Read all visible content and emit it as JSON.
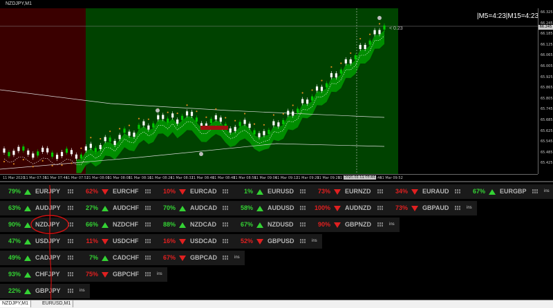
{
  "chart": {
    "title": "NZDJPY,M1",
    "timeframe_label": "|M5=4:23|M15=4:23",
    "price_label": "< 0.23",
    "current_price": "66.245",
    "price_ticks": [
      "66.325",
      "66.245",
      "66.185",
      "66.125",
      "66.065",
      "66.005",
      "65.925",
      "65.865",
      "65.805",
      "65.745",
      "65.685",
      "65.625",
      "65.545",
      "65.485",
      "65.425"
    ],
    "time_ticks": [
      "11 Mar 2020",
      "11 Mar 07:36",
      "11 Mar 07:44",
      "11 Mar 07:52",
      "11 Mar 08:00",
      "11 Mar 08:08",
      "11 Mar 08:16",
      "11 Mar 08:24",
      "11 Mar 08:32",
      "11 Mar 08:40",
      "11 Mar 08:48",
      "11 Mar 08:56",
      "11 Mar 09:04",
      "11 Mar 09:12",
      "11 Mar 09:20",
      "11 Mar 09:28",
      "11 Mar 09:36",
      "11 Mar 09:44",
      "11 Mar 09:52"
    ],
    "time_cursor": "2020.03.11 09:44",
    "colors": {
      "red_zone": "#3a0000",
      "green_zone": "#004200",
      "bull": "#ffffff",
      "bear": "#00c800",
      "cloud": "#009a00"
    }
  },
  "panel": {
    "rows": [
      [
        {
          "pct": "79%",
          "dir": "up",
          "sym": "EURJPY"
        },
        {
          "pct": "62%",
          "dir": "down",
          "sym": "EURCHF"
        },
        {
          "pct": "10%",
          "dir": "down",
          "sym": "EURCAD"
        },
        {
          "pct": "1%",
          "dir": "up",
          "sym": "EURUSD"
        },
        {
          "pct": "73%",
          "dir": "down",
          "sym": "EURNZD"
        },
        {
          "pct": "34%",
          "dir": "down",
          "sym": "EURAUD"
        },
        {
          "pct": "67%",
          "dir": "up",
          "sym": "EURGBP"
        }
      ],
      [
        {
          "pct": "63%",
          "dir": "up",
          "sym": "AUDJPY"
        },
        {
          "pct": "27%",
          "dir": "up",
          "sym": "AUDCHF"
        },
        {
          "pct": "70%",
          "dir": "up",
          "sym": "AUDCAD"
        },
        {
          "pct": "58%",
          "dir": "up",
          "sym": "AUDUSD"
        },
        {
          "pct": "100%",
          "dir": "down",
          "sym": "AUDNZD"
        },
        {
          "pct": "73%",
          "dir": "down",
          "sym": "GBPAUD"
        }
      ],
      [
        {
          "pct": "90%",
          "dir": "up",
          "sym": "NZDJPY"
        },
        {
          "pct": "66%",
          "dir": "up",
          "sym": "NZDCHF"
        },
        {
          "pct": "88%",
          "dir": "up",
          "sym": "NZDCAD"
        },
        {
          "pct": "67%",
          "dir": "up",
          "sym": "NZDUSD"
        },
        {
          "pct": "90%",
          "dir": "down",
          "sym": "GBPNZD"
        }
      ],
      [
        {
          "pct": "47%",
          "dir": "up",
          "sym": "USDJPY"
        },
        {
          "pct": "11%",
          "dir": "down",
          "sym": "USDCHF"
        },
        {
          "pct": "16%",
          "dir": "down",
          "sym": "USDCAD"
        },
        {
          "pct": "52%",
          "dir": "down",
          "sym": "GBPUSD"
        }
      ],
      [
        {
          "pct": "49%",
          "dir": "up",
          "sym": "CADJPY"
        },
        {
          "pct": "7%",
          "dir": "up",
          "sym": "CADCHF"
        },
        {
          "pct": "67%",
          "dir": "down",
          "sym": "GBPCAD"
        }
      ],
      [
        {
          "pct": "93%",
          "dir": "up",
          "sym": "CHFJPY"
        },
        {
          "pct": "75%",
          "dir": "down",
          "sym": "GBPCHF"
        }
      ],
      [
        {
          "pct": "22%",
          "dir": "up",
          "sym": "GBPJPY"
        }
      ]
    ],
    "ins_label": "ins",
    "colors": {
      "up": "#34d234",
      "down": "#e02020",
      "symbol": "#b4b4b4",
      "row_bg": "#1a1a1a"
    }
  },
  "tabs": [
    "NZDJPY,M1",
    "EURUSD,M1"
  ]
}
